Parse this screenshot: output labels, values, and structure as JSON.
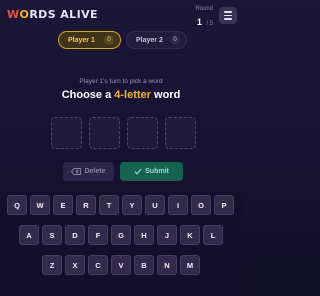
{
  "header": {
    "title_part1": "W",
    "title_part2": "O",
    "title_part3": "RDS ALIVE",
    "round_label": "Round",
    "round_current": "1",
    "round_total": "/ 5",
    "menu_icon": "hamburger-menu-icon"
  },
  "players": [
    {
      "name": "Player 1",
      "score": "0",
      "active": true
    },
    {
      "name": "Player 2",
      "score": "0",
      "active": false
    }
  ],
  "prompt": "Player 1's turn to pick a word",
  "instruction": {
    "prefix": "Choose a ",
    "highlight": "4-letter",
    "suffix": " word"
  },
  "word_slots": [
    "",
    "",
    "",
    ""
  ],
  "actions": {
    "delete_label": "Delete",
    "delete_icon": "backspace-icon",
    "submit_label": "Submit",
    "submit_icon": "checkmark-icon"
  },
  "keyboard": {
    "row1": [
      "Q",
      "W",
      "E",
      "R",
      "T",
      "Y",
      "U",
      "I",
      "O",
      "P"
    ],
    "row2": [
      "A",
      "S",
      "D",
      "F",
      "G",
      "H",
      "J",
      "K",
      "L"
    ],
    "row3": [
      "Z",
      "X",
      "C",
      "V",
      "B",
      "N",
      "M"
    ]
  },
  "colors": {
    "accent": "#f2b431",
    "brand_red": "#e8563f",
    "submit_green": "#16634f",
    "background": "#1c1637"
  }
}
